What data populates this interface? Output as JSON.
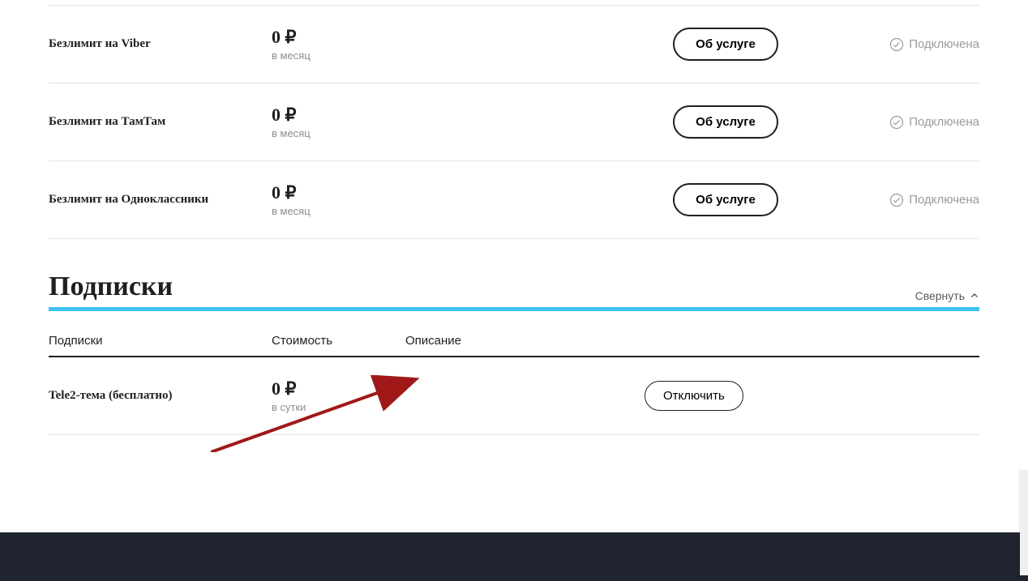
{
  "services": [
    {
      "name": "Безлимит на Viber",
      "price": "0 ₽",
      "period": "в месяц",
      "action": "Об услуге",
      "status": "Подключена"
    },
    {
      "name": "Безлимит на ТамТам",
      "price": "0 ₽",
      "period": "в месяц",
      "action": "Об услуге",
      "status": "Подключена"
    },
    {
      "name": "Безлимит на Одноклассники",
      "price": "0 ₽",
      "period": "в месяц",
      "action": "Об услуге",
      "status": "Подключена"
    }
  ],
  "subscriptions_section": {
    "title": "Подписки",
    "collapse": "Свернуть",
    "headers": {
      "name": "Подписки",
      "cost": "Стоимость",
      "desc": "Описание"
    }
  },
  "subscriptions": [
    {
      "name": "Tele2-тема (бесплатно)",
      "price": "0 ₽",
      "period": "в сутки",
      "action": "Отключить"
    }
  ]
}
